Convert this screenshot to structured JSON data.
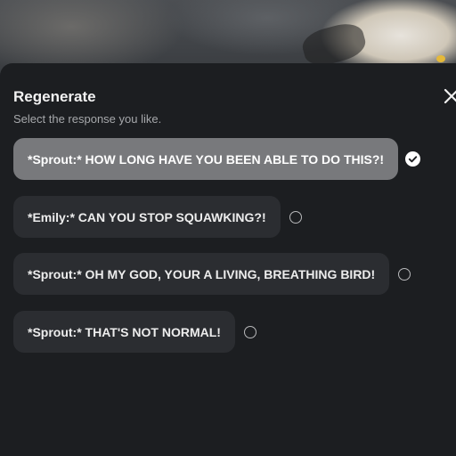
{
  "dialog": {
    "title": "Regenerate",
    "subtitle": "Select the response you like."
  },
  "options": [
    {
      "text": "*Sprout:* HOW LONG HAVE YOU BEEN ABLE TO DO THIS?!",
      "selected": true
    },
    {
      "text": "*Emily:* CAN YOU STOP SQUAWKING?!",
      "selected": false
    },
    {
      "text": "*Sprout:* OH MY GOD, YOUR A LIVING, BREATHING BIRD!",
      "selected": false
    },
    {
      "text": "*Sprout:* THAT'S NOT NORMAL!",
      "selected": false
    }
  ],
  "icons": {
    "close": "close-icon",
    "selected": "check-circle-icon",
    "unselected": "radio-empty-icon"
  },
  "colors": {
    "background": "#1c1e21",
    "bubble": "#2b2d31",
    "bubble_selected": "#78797c"
  }
}
